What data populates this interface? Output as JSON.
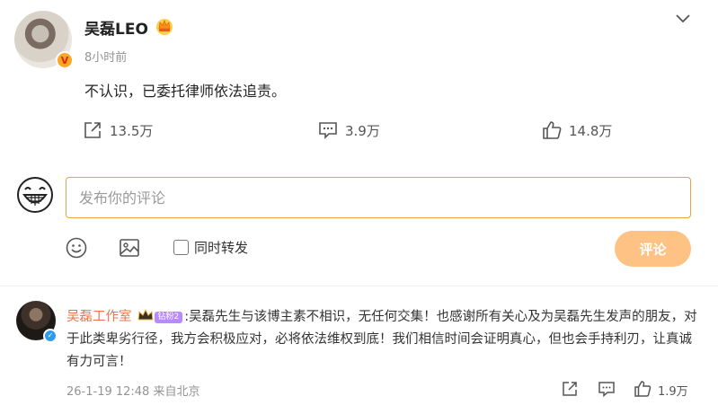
{
  "post": {
    "username": "吴磊LEO",
    "time": "8小时前",
    "text": "不认识，已委托律师依法追责。",
    "actions": {
      "share_count": "13.5万",
      "comment_count": "3.9万",
      "like_count": "14.8万"
    }
  },
  "composer": {
    "placeholder": "发布你的评论",
    "repost_label": "同时转发",
    "submit_label": "评论"
  },
  "comment": {
    "user": "吴磊工作室",
    "fan_badge": "钻粉2",
    "text": ":吴磊先生与该博主素不相识，无任何交集！也感谢所有关心及为吴磊先生发声的朋友，对于此类卑劣行径，我方会积极应对，必将依法维权到底！我们相信时间会证明真心，但也会手持利刃，让真诚有力可言！",
    "meta": "26-1-19 12:48 来自北京",
    "like_count": "1.9万"
  },
  "colors": {
    "accent": "#ff8200",
    "username_link": "#eb7350",
    "submit_disabled": "#ffc285",
    "muted": "#939393"
  },
  "icons": [
    "verified-icon",
    "crown-icon",
    "chevron-down-icon",
    "share-icon",
    "comment-icon",
    "like-icon",
    "emoji-icon",
    "image-icon"
  ]
}
